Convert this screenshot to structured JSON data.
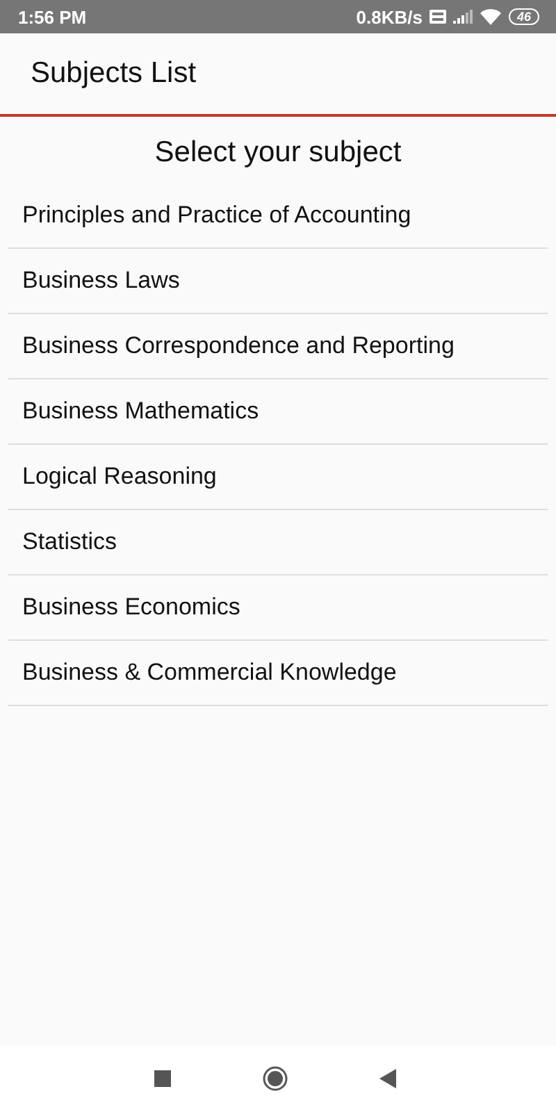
{
  "status_bar": {
    "time": "1:56 PM",
    "speed": "0.8KB/s",
    "battery": "46"
  },
  "app_bar": {
    "title": "Subjects List"
  },
  "heading": "Select your subject",
  "subjects": [
    "Principles and Practice of Accounting",
    "Business Laws",
    "Business Correspondence and Reporting",
    "Business Mathematics",
    "Logical Reasoning",
    "Statistics",
    "Business Economics",
    "Business & Commercial Knowledge"
  ]
}
